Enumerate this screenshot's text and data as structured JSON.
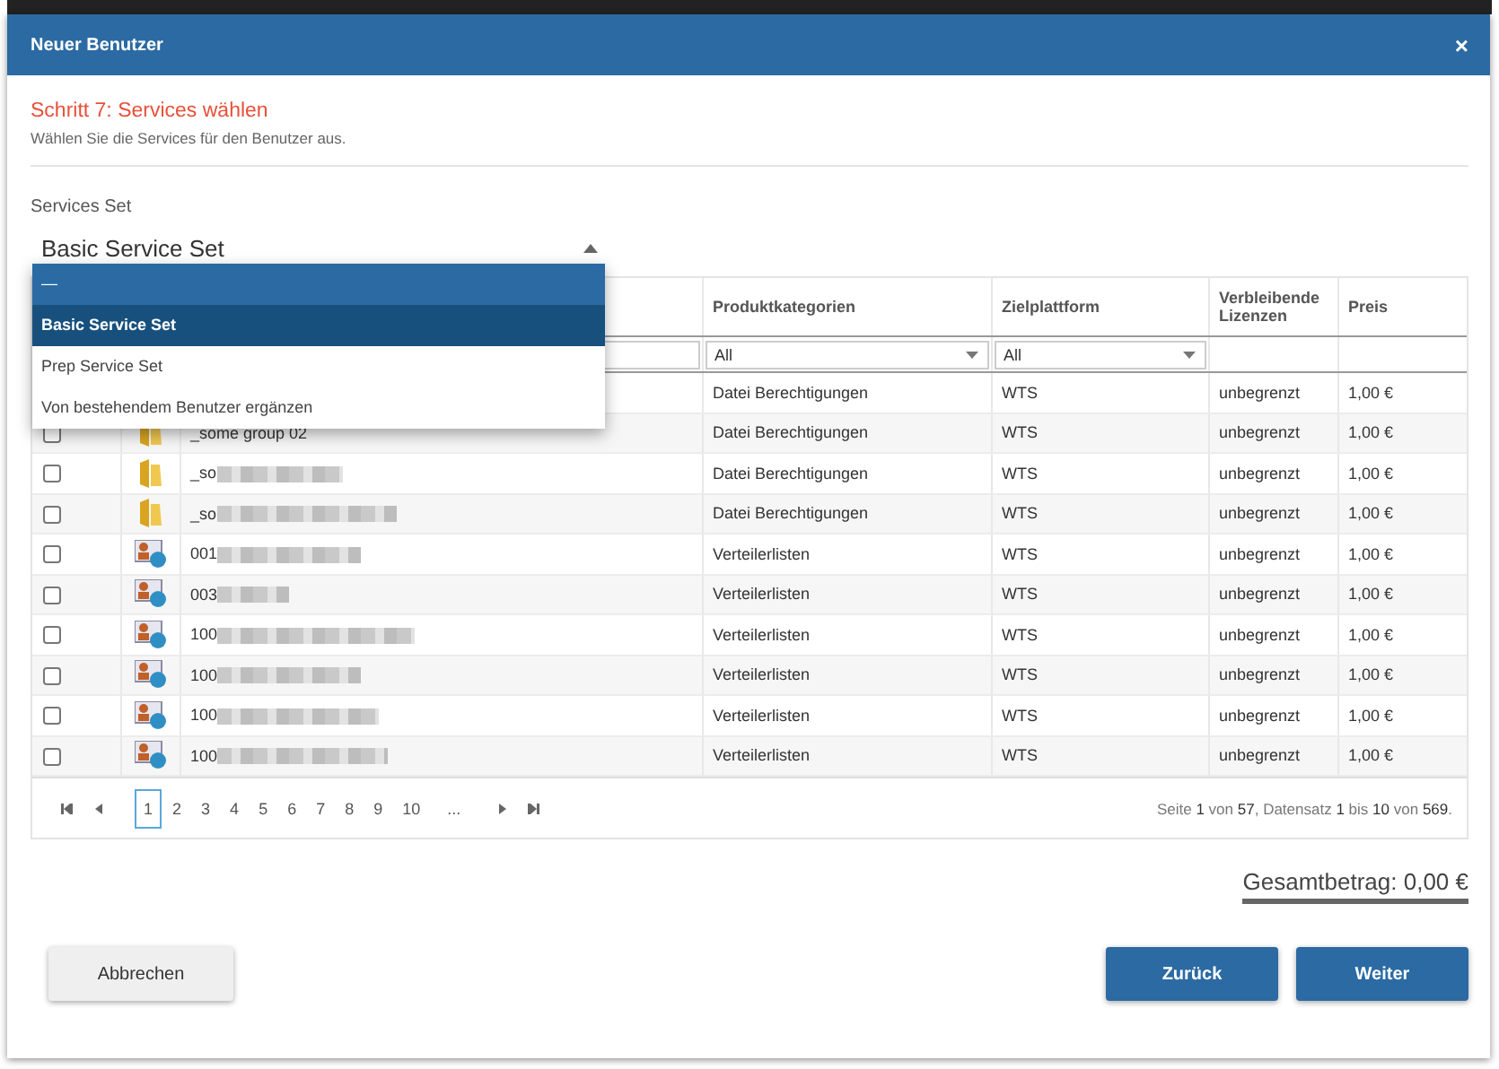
{
  "window": {
    "title": "Neuer Benutzer",
    "close": "×"
  },
  "step": {
    "title": "Schritt 7: Services wählen",
    "subtitle": "Wählen Sie die Services für den Benutzer aus."
  },
  "services_set": {
    "label": "Services Set",
    "value": "Basic Service Set",
    "expanded": true,
    "options": [
      {
        "label": "—",
        "selected": false,
        "kind": "empty"
      },
      {
        "label": "Basic Service Set",
        "selected": true,
        "kind": "option"
      },
      {
        "label": "Prep Service Set",
        "selected": false,
        "kind": "option"
      },
      {
        "label": "Von bestehendem Benutzer ergänzen",
        "selected": false,
        "kind": "option"
      }
    ]
  },
  "table": {
    "columns": [
      {
        "label": "Produktkategorien",
        "filter": "All"
      },
      {
        "label": "Zielplattform",
        "filter": "All"
      },
      {
        "label": "Verbleibende Lizenzen"
      },
      {
        "label": "Preis"
      }
    ],
    "rows": [
      {
        "kind": "hidden",
        "category": "Datei Berechtigungen",
        "platform": "WTS",
        "licenses": "unbegrenzt",
        "price": "1,00 €"
      },
      {
        "kind": "folder",
        "checked": false,
        "name": "_some group 02",
        "category": "Datei Berechtigungen",
        "platform": "WTS",
        "licenses": "unbegrenzt",
        "price": "1,00 €"
      },
      {
        "kind": "folder",
        "checked": false,
        "name": "_so",
        "category": "Datei Berechtigungen",
        "platform": "WTS",
        "licenses": "unbegrenzt",
        "price": "1,00 €"
      },
      {
        "kind": "folder",
        "checked": false,
        "name": "_so",
        "category": "Datei Berechtigungen",
        "platform": "WTS",
        "licenses": "unbegrenzt",
        "price": "1,00 €"
      },
      {
        "kind": "contact",
        "checked": false,
        "name": "001",
        "category": "Verteilerlisten",
        "platform": "WTS",
        "licenses": "unbegrenzt",
        "price": "1,00 €"
      },
      {
        "kind": "contact",
        "checked": false,
        "name": "003",
        "category": "Verteilerlisten",
        "platform": "WTS",
        "licenses": "unbegrenzt",
        "price": "1,00 €"
      },
      {
        "kind": "contact",
        "checked": false,
        "name": "100",
        "category": "Verteilerlisten",
        "platform": "WTS",
        "licenses": "unbegrenzt",
        "price": "1,00 €"
      },
      {
        "kind": "contact",
        "checked": false,
        "name": "100",
        "category": "Verteilerlisten",
        "platform": "WTS",
        "licenses": "unbegrenzt",
        "price": "1,00 €"
      },
      {
        "kind": "contact",
        "checked": false,
        "name": "100",
        "category": "Verteilerlisten",
        "platform": "WTS",
        "licenses": "unbegrenzt",
        "price": "1,00 €"
      },
      {
        "kind": "contact",
        "checked": false,
        "name": "100",
        "category": "Verteilerlisten",
        "platform": "WTS",
        "licenses": "unbegrenzt",
        "price": "1,00 €"
      }
    ]
  },
  "pager": {
    "pages": [
      {
        "label": "1",
        "selected": true
      },
      {
        "label": "2",
        "selected": false
      },
      {
        "label": "3",
        "selected": false
      },
      {
        "label": "4",
        "selected": false
      },
      {
        "label": "5",
        "selected": false
      },
      {
        "label": "6",
        "selected": false
      },
      {
        "label": "7",
        "selected": false
      },
      {
        "label": "8",
        "selected": false
      },
      {
        "label": "9",
        "selected": false
      },
      {
        "label": "10",
        "selected": false
      },
      {
        "label": "...",
        "selected": false
      }
    ],
    "info": "Seite **1** von **57**, Datensatz **1** bis **10** von **569**."
  },
  "total": "Gesamtbetrag: 0,00 €",
  "buttons": {
    "cancel": "Abbrechen",
    "back": "Zurück",
    "next": "Weiter"
  }
}
